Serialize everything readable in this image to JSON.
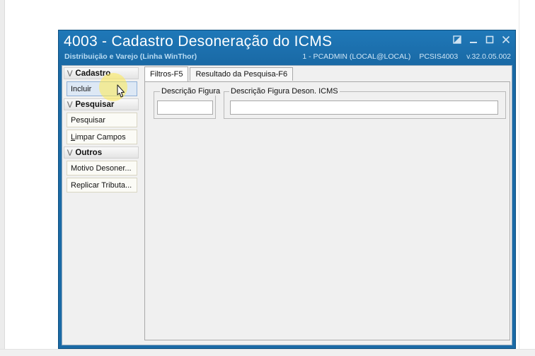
{
  "window": {
    "title": "4003 - Cadastro Desoneração do ICMS",
    "subtitle": "Distribuição e Varejo (Linha WinThor)",
    "status_user": "1 - PCADMIN (LOCAL@LOCAL)",
    "status_routine": "PCSIS4003",
    "status_version": "v.32.0.05.002"
  },
  "sidebar": {
    "groups": [
      {
        "label": "Cadastro",
        "items": [
          {
            "label": "Incluir"
          }
        ]
      },
      {
        "label": "Pesquisar",
        "items": [
          {
            "label": "Pesquisar"
          },
          {
            "label": "Limpar Campos",
            "underline": "L"
          }
        ]
      },
      {
        "label": "Outros",
        "items": [
          {
            "label": "Motivo Desoner..."
          },
          {
            "label": "Replicar Tributa..."
          }
        ]
      }
    ]
  },
  "tabs": [
    {
      "label": "Filtros-F5",
      "active": true
    },
    {
      "label": "Resultado da Pesquisa-F6",
      "active": false
    }
  ],
  "filters": {
    "descricao_figura": {
      "label": "Descrição Figura",
      "value": ""
    },
    "descricao_figura_deson": {
      "label": "Descrição Figura Deson. ICMS",
      "value": ""
    }
  },
  "icons": {
    "window_controls": [
      "restore-icon",
      "minimize-icon",
      "maximize-icon",
      "close-icon"
    ],
    "group_toggle": "chevron-down-icon",
    "cursor": "mouse-pointer-icon"
  },
  "colors": {
    "titlebar": "#1a6aa6",
    "client_bg": "#f0f0f0",
    "active_button_bg": "#dde8f5",
    "cursor_highlight": "#ffeb50"
  }
}
